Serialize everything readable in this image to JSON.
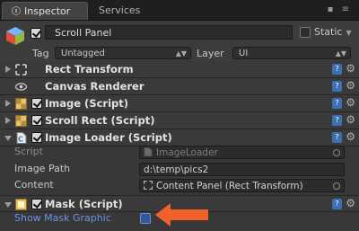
{
  "tabs": {
    "inspector": "Inspector",
    "services": "Services"
  },
  "window_controls": "▪ ≡",
  "gameobject": {
    "name": "Scroll Panel",
    "active": true,
    "static_label": "Static",
    "static_checked": false,
    "tag_label": "Tag",
    "tag_value": "Untagged",
    "layer_label": "Layer",
    "layer_value": "UI"
  },
  "components": [
    {
      "title": "Rect Transform",
      "has_checkbox": false,
      "expanded": false,
      "icon": "rect-transform-icon"
    },
    {
      "title": "Canvas Renderer",
      "has_checkbox": false,
      "expanded": false,
      "icon": "eye-icon"
    },
    {
      "title": "Image (Script)",
      "has_checkbox": true,
      "expanded": false,
      "icon": "image-script-icon"
    },
    {
      "title": "Scroll Rect (Script)",
      "has_checkbox": true,
      "expanded": false,
      "icon": "scroll-rect-icon"
    },
    {
      "title": "Image Loader (Script)",
      "has_checkbox": true,
      "expanded": true,
      "icon": "csharp-script-icon"
    },
    {
      "title": "Mask (Script)",
      "has_checkbox": true,
      "expanded": true,
      "icon": "mask-script-icon"
    }
  ],
  "image_loader": {
    "script_label": "Script",
    "script_value": "ImageLoader",
    "image_path_label": "Image Path",
    "image_path_value": "d:\\temp\\pics2",
    "content_label": "Content",
    "content_value": "Content Panel (Rect Transform)"
  },
  "mask": {
    "show_mask_graphic_label": "Show Mask Graphic",
    "show_mask_graphic_checked": false
  },
  "colors": {
    "accent_blue": "#6c93e0",
    "arrow_orange": "#f0622a",
    "panel_bg": "#383838"
  }
}
